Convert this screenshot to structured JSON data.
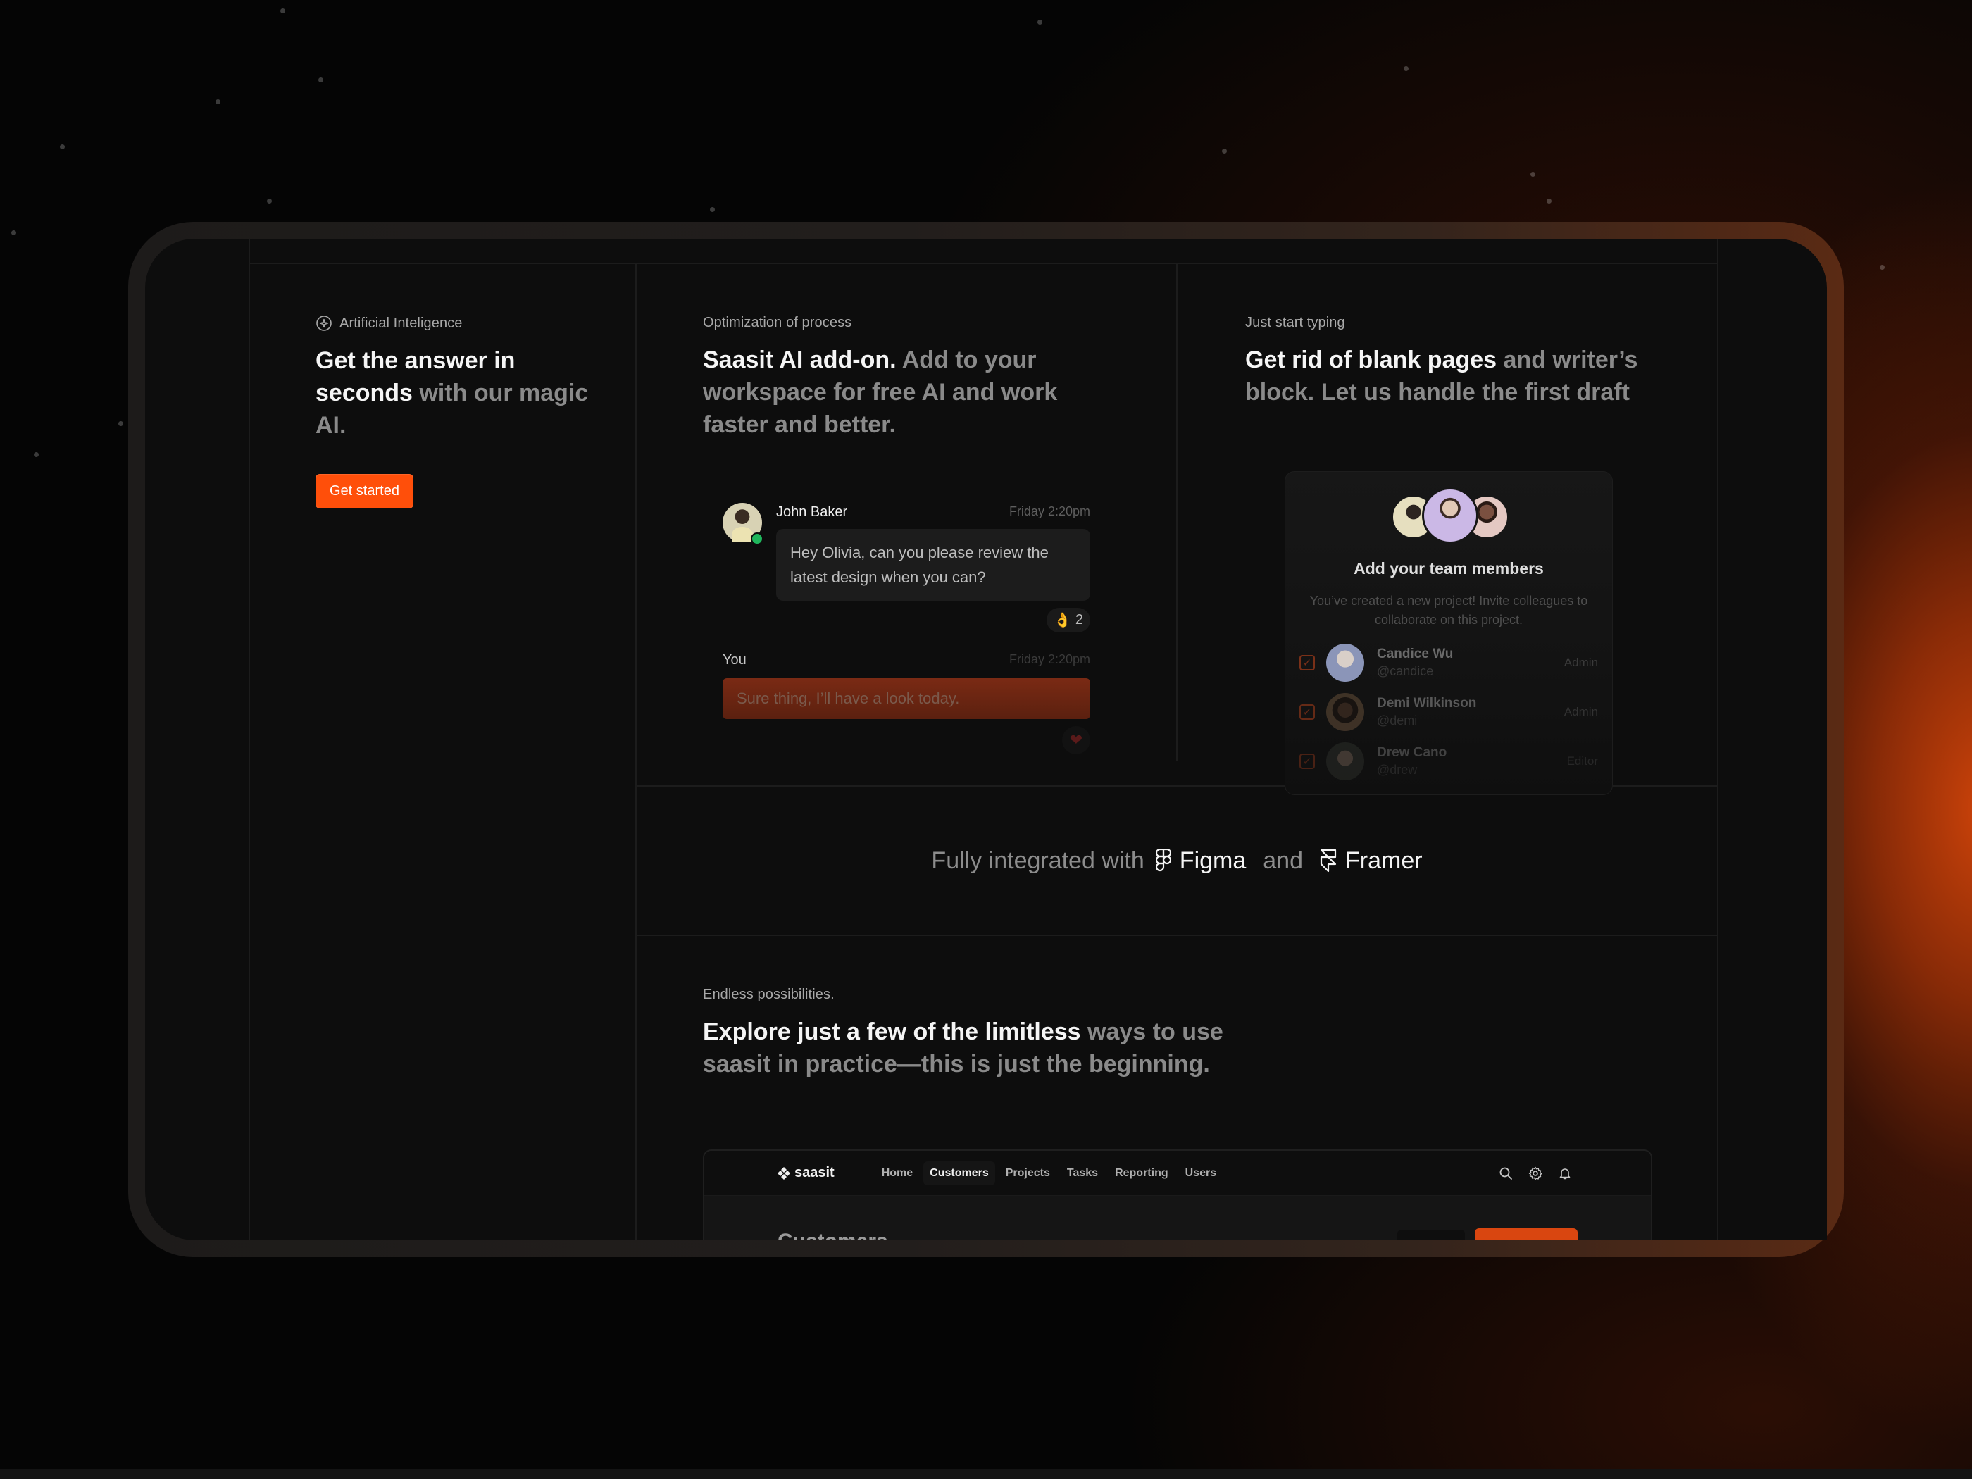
{
  "colors": {
    "accent": "#ff4f0a",
    "background": "#0d0d0d",
    "online": "#1fb65c"
  },
  "feature_ai": {
    "icon": "sparkle-circle-icon",
    "eyebrow": "Artificial Inteligence",
    "headline_strong": "Get the answer in seconds",
    "headline_rest": " with our magic AI.",
    "cta_label": "Get started"
  },
  "feature_addon": {
    "eyebrow": "Optimization of process",
    "headline_strong": "Saasit AI add-on.",
    "headline_rest": " Add to your workspace for free AI and work faster and better.",
    "chat": {
      "incoming": {
        "sender": "John Baker",
        "time": "Friday 2:20pm",
        "text": "Hey Olivia, can you please review the latest design when you can?",
        "reaction_emoji": "👌",
        "reaction_count": "2",
        "status": "online"
      },
      "outgoing": {
        "sender": "You",
        "time": "Friday 2:20pm",
        "text": "Sure thing, I’ll have a look today.",
        "reaction_emoji": "❤"
      }
    }
  },
  "feature_typing": {
    "eyebrow": "Just start typing",
    "headline_strong": "Get rid of blank pages",
    "headline_rest": " and writer’s block. Let us handle the first draft",
    "team_card": {
      "title": "Add your team members",
      "subtitle": "You’ve created a new project! Invite colleagues to collaborate on this project.",
      "members": [
        {
          "name": "Candice Wu",
          "handle": "@candice",
          "role": "Admin",
          "checked": true
        },
        {
          "name": "Demi Wilkinson",
          "handle": "@demi",
          "role": "Admin",
          "checked": true
        },
        {
          "name": "Drew Cano",
          "handle": "@drew",
          "role": "Editor",
          "checked": true
        }
      ]
    }
  },
  "integrations": {
    "lead": "Fully integrated with",
    "first": "Figma",
    "joiner": "and",
    "second": "Framer"
  },
  "endless": {
    "eyebrow": "Endless possibilities.",
    "headline_strong": "Explore just a few of the limitless",
    "headline_rest": " ways to use saasit in practice—this is just the beginning."
  },
  "mock_app": {
    "logo": "saasit",
    "nav": [
      "Home",
      "Customers",
      "Projects",
      "Tasks",
      "Reporting",
      "Users"
    ],
    "active_nav": "Customers",
    "page_title": "Customers",
    "icons": [
      "search-icon",
      "gear-icon",
      "bell-icon"
    ]
  }
}
